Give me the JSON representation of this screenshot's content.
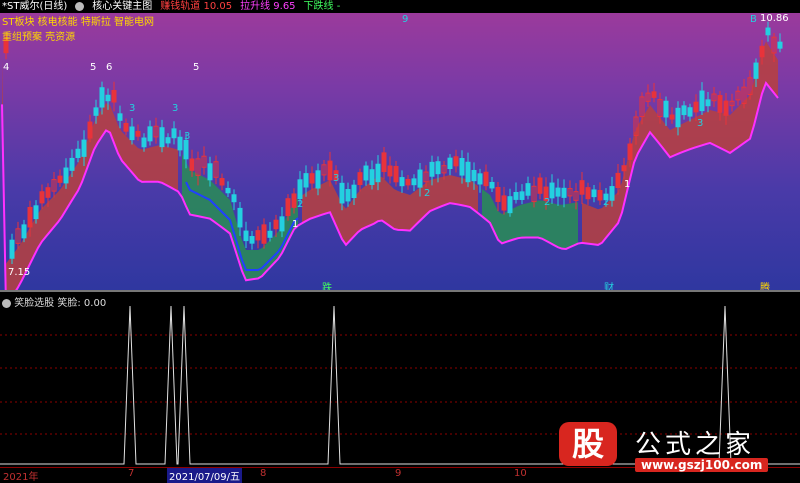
{
  "header": {
    "ticker": "*ST威尔(日线)",
    "main_chart_name": "核心关键主图",
    "line1_label": "赚钱轨道",
    "line1_value": "10.05",
    "line2_label": "拉升线",
    "line2_value": "9.65",
    "line3_label": "下跌线",
    "line3_value": "-"
  },
  "tags": {
    "line1": "ST板块 核电核能 特斯拉 智能电网",
    "line2": "重组预案 壳资源"
  },
  "price": {
    "high_label": "10.86",
    "low_label": "7.15"
  },
  "markers": {
    "m4": "4",
    "m5a": "5",
    "m6": "6",
    "m5b": "5",
    "m9": "9",
    "mB": "B",
    "c3a": "3",
    "c3b": "3",
    "c3c": "3",
    "c2a": "2",
    "c1a": "1",
    "c3d": "3",
    "c2b": "2",
    "c2c": "2",
    "c2d": "2",
    "c1b": "1",
    "c3e": "3"
  },
  "event_labels": {
    "die": "跌",
    "cai": "财",
    "teng": "腾"
  },
  "indicator": {
    "name": "笑脸选股",
    "value_label": "笑脸: 0.00"
  },
  "date_axis": {
    "year": "2021年",
    "m7": "7",
    "current": "2021/07/09/五",
    "m8": "8",
    "m9": "9",
    "m10": "10"
  },
  "logo": {
    "mark": "股",
    "name": "公式之家",
    "url": "www.gszj100.com"
  },
  "colors": {
    "up": "#e8333a",
    "down": "#24d0e0",
    "band_red": "#b8413e",
    "band_green": "#2a8a5a",
    "magenta_line": "#ff30ff",
    "blue_line": "#2040ff"
  }
}
